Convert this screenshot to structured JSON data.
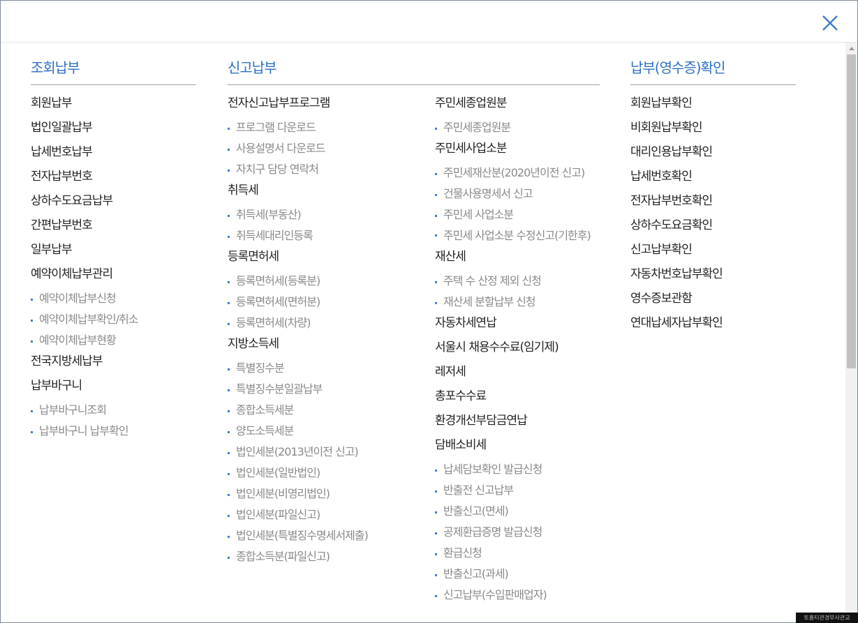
{
  "columns": {
    "inquiry": {
      "title": "조회납부",
      "items": [
        "회원납부",
        "법인일괄납부",
        "납세번호납부",
        "전자납부번호",
        "상하수도요금납부",
        "간편납부번호",
        "일부납부"
      ],
      "reserve": {
        "label": "예약이체납부관리",
        "subs": [
          "예약이체납부신청",
          "예약이체납부확인/취소",
          "예약이체납부현황"
        ]
      },
      "nationwide": "전국지방세납부",
      "basket": {
        "label": "납부바구니",
        "subs": [
          "납부바구니조회",
          "납부바구니 납부확인"
        ]
      }
    },
    "report": {
      "title": "신고납부",
      "left": {
        "program": {
          "label": "전자신고납부프로그램",
          "subs": [
            "프로그램 다운로드",
            "사용설명서 다운로드",
            "자치구 담당 연락처"
          ]
        },
        "acquisition": {
          "label": "취득세",
          "subs": [
            "취득세(부동산)",
            "취득세대리인등록"
          ]
        },
        "registration": {
          "label": "등록면허세",
          "subs": [
            "등록면허세(등록분)",
            "등록면허세(면허분)",
            "등록면허세(차량)"
          ]
        },
        "income": {
          "label": "지방소득세",
          "subs": [
            "특별징수분",
            "특별징수분일괄납부",
            "종합소득세분",
            "양도소득세분",
            "법인세분(2013년이전 신고)",
            "법인세분(일반법인)",
            "법인세분(비영리법인)",
            "법인세분(파일신고)",
            "법인세분(특별징수명세서제출)",
            "종합소득분(파일신고)"
          ]
        }
      },
      "right": {
        "employee": {
          "label": "주민세종업원분",
          "subs": [
            "주민세종업원분"
          ]
        },
        "business": {
          "label": "주민세사업소분",
          "subs": [
            "주민세재산분(2020년이전 신고)",
            "건물사용명세서 신고",
            "주민세 사업소분"
          ],
          "wrap_sub": "주민세 사업소분 수정신고(기한후)"
        },
        "property": {
          "label": "재산세",
          "subs": [
            "주택 수 산정 제외 신청",
            "재산세 분할납부 신청"
          ]
        },
        "car_annual": "자동차세연납",
        "seoul_fee": "서울시 채용수수료(임기제)",
        "leisure": "레저세",
        "hunting": "총포수수료",
        "env": "환경개선부담금연납",
        "tobacco": {
          "label": "담배소비세",
          "subs": [
            "납세담보확인 발급신청",
            "반출전 신고납부",
            "반출신고(면세)",
            "공제환급증명 발급신청",
            "환급신청",
            "반출신고(과세)",
            "신고납부(수입판매업자)"
          ]
        }
      }
    },
    "receipt": {
      "title": "납부(영수증)확인",
      "items": [
        "회원납부확인",
        "비회원납부확인",
        "대리인용납부확인",
        "납세번호확인",
        "전자납부번호확인",
        "상하수도요금확인",
        "신고납부확인",
        "자동차번호납부확인",
        "영수증보관함",
        "연대납세자납부확인"
      ]
    }
  },
  "watermark": "토홈티관경부사관교",
  "icons": {
    "close": "close-icon"
  },
  "colors": {
    "accent": "#2d6fc4",
    "item_text": "#222222",
    "sub_text": "#8a8a8a",
    "bullet": "#3f7fcf"
  }
}
